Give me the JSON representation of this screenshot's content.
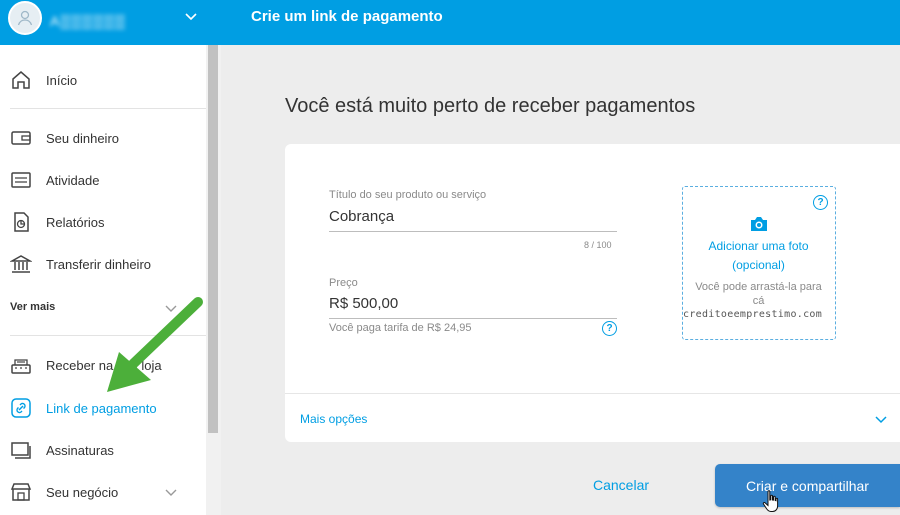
{
  "header": {
    "user_name": "A▒▒▒▒▒▒",
    "page_title": "Crie um link de pagamento"
  },
  "sidebar": {
    "items": [
      {
        "label": "Início",
        "icon": "home-icon"
      },
      {
        "label": "Seu dinheiro",
        "icon": "wallet-icon"
      },
      {
        "label": "Atividade",
        "icon": "activity-icon"
      },
      {
        "label": "Relatórios",
        "icon": "report-icon"
      },
      {
        "label": "Transferir dinheiro",
        "icon": "bank-icon"
      },
      {
        "label": "Receber na sua loja",
        "icon": "cash-register-icon"
      },
      {
        "label": "Link de pagamento",
        "icon": "link-icon"
      },
      {
        "label": "Assinaturas",
        "icon": "subscriptions-icon"
      },
      {
        "label": "Seu negócio",
        "icon": "store-icon"
      }
    ],
    "section_more": "Ver mais",
    "active_item": "Link de pagamento"
  },
  "main": {
    "heading": "Você está muito perto de receber pagamentos",
    "product_title": {
      "label": "Título do seu produto ou serviço",
      "value": "Cobrança",
      "counter": "8 / 100"
    },
    "price": {
      "label": "Preço",
      "value": "R$ 500,00",
      "fee_note": "Você paga tarifa de R$ 24,95"
    },
    "photo": {
      "title_line1": "Adicionar uma foto",
      "title_line2": "(opcional)",
      "hint_line1": "Você pode arrastá-la para",
      "hint_line2": "cá"
    },
    "watermark": "creditoeemprestimo.com",
    "more_options": "Mais opções",
    "cancel_label": "Cancelar",
    "submit_label": "Criar e compartilhar"
  },
  "colors": {
    "brand_blue": "#009ee3",
    "button_blue": "#3483c9",
    "arrow_green": "#4caf3a"
  }
}
